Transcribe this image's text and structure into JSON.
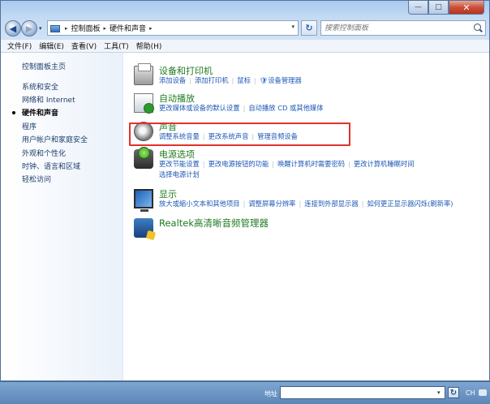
{
  "window": {
    "minimize_glyph": "—",
    "maximize_glyph": "□",
    "close_glyph": "✕"
  },
  "address": {
    "back_glyph": "◀",
    "forward_glyph": "▶",
    "dropdown_glyph": "▾",
    "crumb_sep": "▸",
    "crumbs": [
      "控制面板",
      "硬件和声音"
    ],
    "refresh_glyph": "↻",
    "search_placeholder": "搜索控制面板"
  },
  "menubar": {
    "items": [
      "文件(F)",
      "编辑(E)",
      "查看(V)",
      "工具(T)",
      "帮助(H)"
    ]
  },
  "sidebar": {
    "items": [
      "控制面板主页",
      "系统和安全",
      "网络和 Internet",
      "硬件和声音",
      "程序",
      "用户帐户和家庭安全",
      "外观和个性化",
      "时钟、语言和区域",
      "轻松访问"
    ],
    "current_index": 3
  },
  "categories": [
    {
      "title": "设备和打印机",
      "icon": "printer-icon",
      "links": [
        "添加设备",
        "添加打印机",
        "鼠标",
        "设备管理器"
      ],
      "links2": []
    },
    {
      "title": "自动播放",
      "icon": "autoplay-icon",
      "links": [
        "更改媒体或设备的默认设置",
        "自动播放 CD 或其他媒体"
      ],
      "links2": []
    },
    {
      "title": "声音",
      "icon": "speaker-icon",
      "links": [
        "调整系统音量",
        "更改系统声音",
        "管理音频设备"
      ],
      "links2": []
    },
    {
      "title": "电源选项",
      "icon": "power-icon",
      "links": [
        "更改节能设置",
        "更改电源按钮的功能",
        "唤醒计算机时需要密码",
        "更改计算机睡眠时间"
      ],
      "links2": [
        "选择电源计划"
      ]
    },
    {
      "title": "显示",
      "icon": "display-icon",
      "links": [
        "放大或缩小文本和其他项目",
        "调整屏幕分辨率",
        "连接到外部显示器",
        "如何更正显示器闪烁(刷新率)"
      ],
      "links2": []
    },
    {
      "title": "Realtek高清晰音频管理器",
      "icon": "realtek-icon",
      "links": [],
      "links2": []
    }
  ],
  "statusbar": {
    "address_label": "地址",
    "dropdown_glyph": "▾",
    "go_glyph": "↻",
    "lang_indicator": "CH"
  },
  "colors": {
    "highlight_border": "#e0322c",
    "category_title": "#1f7a1f",
    "link": "#1c57b5"
  }
}
